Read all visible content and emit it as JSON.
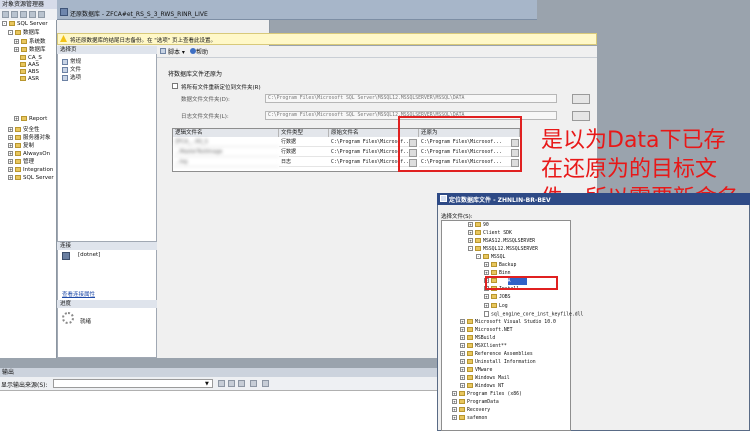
{
  "explorer": {
    "title": "对象资源管理器",
    "tree": [
      {
        "label": "SQL Server",
        "toggle": "-",
        "icon": "server-icon"
      },
      {
        "label": "数据库",
        "toggle": "-",
        "icon": "folder-icon"
      },
      {
        "label": "系统数",
        "toggle": "+",
        "icon": "folder-icon"
      },
      {
        "label": "数据库",
        "toggle": "+",
        "icon": "folder-icon"
      },
      {
        "label": "CA_S",
        "toggle": "",
        "icon": "database-icon"
      },
      {
        "label": "AAS",
        "toggle": "",
        "icon": "database-icon"
      },
      {
        "label": "ABS",
        "toggle": "",
        "icon": "database-icon"
      },
      {
        "label": "ASR",
        "toggle": "",
        "icon": "database-icon"
      },
      {
        "label": "Report",
        "toggle": "+",
        "icon": "database-icon"
      },
      {
        "label": "安全性",
        "toggle": "+",
        "icon": "folder-icon"
      },
      {
        "label": "服务器对象",
        "toggle": "+",
        "icon": "folder-icon"
      },
      {
        "label": "复制",
        "toggle": "+",
        "icon": "folder-icon"
      },
      {
        "label": "AlwaysOn",
        "toggle": "+",
        "icon": "folder-icon"
      },
      {
        "label": "管理",
        "toggle": "+",
        "icon": "folder-icon"
      },
      {
        "label": "Integration",
        "toggle": "+",
        "icon": "folder-icon"
      },
      {
        "label": "SQL Server",
        "toggle": "+",
        "icon": "agent-icon"
      }
    ]
  },
  "dialog": {
    "title": "还原数据库 - ZFCA#et_RS_S_3_RWS_RINR_LIVE",
    "warning": "将还原数据库的结尾日志备份。在 \"选项\" 页上查看此设置。",
    "pages_header": "选择页",
    "pages": [
      "常规",
      "文件",
      "选项"
    ],
    "toolbar": {
      "script_label": "脚本",
      "help_label": "帮助"
    },
    "connection_header": "连接",
    "connection_server": "[dotnet]",
    "connection_link": "查看连接属性",
    "progress_header": "进度",
    "progress_status": "就绪",
    "section_title": "将数据库文件还原为",
    "relocate_label": "将所有文件重新定位到文件夹(R)",
    "data_folder_label": "数据文件文件夹(D):",
    "data_folder_value": "C:\\Program Files\\Microsoft SQL Server\\MSSQL12.MSSQLSERVER\\MSSQL\\DATA",
    "log_folder_label": "日志文件文件夹(L):",
    "log_folder_value": "C:\\Program Files\\Microsoft SQL Server\\MSSQL12.MSSQLSERVER\\MSSQL\\DATA",
    "grid_title": "",
    "grid": {
      "columns": [
        "逻辑文件名",
        "文件类型",
        "原始文件名",
        "还原为"
      ],
      "rows": [
        [
          "ZFCA_...RS_S",
          "行数据",
          "C:\\Program Files\\Microsof...",
          "C:\\Program Files\\Microsof..."
        ],
        [
          "...MasterTestImage",
          "行数据",
          "C:\\Program Files\\Microsof...",
          "C:\\Program Files\\Microsof..."
        ],
        [
          "...log",
          "日志",
          "C:\\Program Files\\Microsof...",
          "C:\\Program Files\\Microsof..."
        ]
      ]
    }
  },
  "annotation": {
    "text": "是以为Data下已存在还原为的目标文件，所以需要新命名下 就可以了",
    "color": "#e81818"
  },
  "locate_dialog": {
    "title": "定位数据库文件 - ZHNLIN-BR-BEV",
    "label": "选择文件(S):",
    "tree": [
      {
        "label": "90",
        "toggle": "+",
        "depth": 2,
        "kind": "folder"
      },
      {
        "label": "Client SDK",
        "toggle": "+",
        "depth": 2,
        "kind": "folder"
      },
      {
        "label": "MSAS12.MSSQLSERVER",
        "toggle": "+",
        "depth": 2,
        "kind": "folder"
      },
      {
        "label": "MSSQL12.MSSQLSERVER",
        "toggle": "-",
        "depth": 2,
        "kind": "folder"
      },
      {
        "label": "MSSQL",
        "toggle": "-",
        "depth": 3,
        "kind": "folder"
      },
      {
        "label": "Backup",
        "toggle": "+",
        "depth": 4,
        "kind": "folder"
      },
      {
        "label": "Binn",
        "toggle": "+",
        "depth": 4,
        "kind": "folder"
      },
      {
        "label": "DATA",
        "toggle": "+",
        "depth": 4,
        "kind": "folder",
        "selected": true
      },
      {
        "label": "Install",
        "toggle": "+",
        "depth": 4,
        "kind": "folder"
      },
      {
        "label": "JOBS",
        "toggle": "+",
        "depth": 4,
        "kind": "folder"
      },
      {
        "label": "Log",
        "toggle": "+",
        "depth": 4,
        "kind": "folder"
      },
      {
        "label": "sql_engine_core_inst_keyfile.dll",
        "toggle": "",
        "depth": 4,
        "kind": "file"
      },
      {
        "label": "Microsoft Visual Studio 10.0",
        "toggle": "+",
        "depth": 1,
        "kind": "folder"
      },
      {
        "label": "Microsoft.NET",
        "toggle": "+",
        "depth": 1,
        "kind": "folder"
      },
      {
        "label": "MSBuild",
        "toggle": "+",
        "depth": 1,
        "kind": "folder"
      },
      {
        "label": "MSXClient**",
        "toggle": "+",
        "depth": 1,
        "kind": "folder"
      },
      {
        "label": "Reference Assemblies",
        "toggle": "+",
        "depth": 1,
        "kind": "folder"
      },
      {
        "label": "Uninstall Information",
        "toggle": "+",
        "depth": 1,
        "kind": "folder"
      },
      {
        "label": "VMware",
        "toggle": "+",
        "depth": 1,
        "kind": "folder"
      },
      {
        "label": "Windows Mail",
        "toggle": "+",
        "depth": 1,
        "kind": "folder"
      },
      {
        "label": "Windows NT",
        "toggle": "+",
        "depth": 1,
        "kind": "folder"
      },
      {
        "label": "Program Files (x86)",
        "toggle": "+",
        "depth": 0,
        "kind": "folder"
      },
      {
        "label": "ProgramData",
        "toggle": "+",
        "depth": 0,
        "kind": "folder"
      },
      {
        "label": "Recovery",
        "toggle": "+",
        "depth": 0,
        "kind": "folder"
      },
      {
        "label": "safemon",
        "toggle": "+",
        "depth": 0,
        "kind": "folder"
      }
    ]
  },
  "output": {
    "title": "输出",
    "source_label": "显示输出来源(S):",
    "source_value": ""
  }
}
